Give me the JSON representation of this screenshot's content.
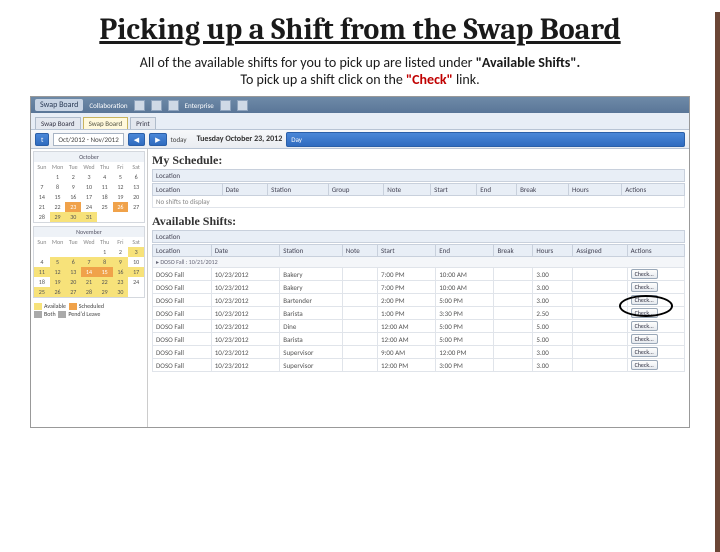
{
  "title": "Picking up a Shift from the Swap Board",
  "body_line1_a": "All of the available shifts for you to pick up are listed under ",
  "body_line1_b": "\"Available Shifts\".",
  "body_line2_a": "To pick up a shift click on the ",
  "body_line2_b": "\"Check\"",
  "body_line2_c": " link.",
  "app": {
    "top_tab": "Swap Board",
    "top_menu1": "Collaboration",
    "top_menu2": "Enterprise",
    "tabs": [
      "Swap Board",
      "Swap Board",
      "Print"
    ],
    "nav": {
      "btn": "t",
      "range": "Oct/2012 - Nov/2012",
      "today_sub": "today",
      "date": "Tuesday October 23, 2012",
      "day_btn": "Day"
    }
  },
  "cal": {
    "dow": [
      "Sun",
      "Mon",
      "Tue",
      "Wed",
      "Thu",
      "Fri",
      "Sat"
    ],
    "m1": {
      "name": "October",
      "rows": [
        [
          "",
          "1",
          "2",
          "3",
          "4",
          "5",
          "6"
        ],
        [
          "7",
          "8",
          "9",
          "10",
          "11",
          "12",
          "13"
        ],
        [
          "14",
          "15",
          "16",
          "17",
          "18",
          "19",
          "20"
        ],
        [
          "21",
          "22",
          "23",
          "24",
          "25",
          "26",
          "27"
        ],
        [
          "28",
          "29",
          "30",
          "31",
          "",
          "",
          ""
        ]
      ],
      "orange": [
        "23",
        "26"
      ],
      "yellow": [
        "29",
        "30",
        "31"
      ]
    },
    "m2": {
      "name": "November",
      "rows": [
        [
          "",
          "",
          "",
          "",
          "1",
          "2",
          "3"
        ],
        [
          "4",
          "5",
          "6",
          "7",
          "8",
          "9",
          "10"
        ],
        [
          "11",
          "12",
          "13",
          "14",
          "15",
          "16",
          "17"
        ],
        [
          "18",
          "19",
          "20",
          "21",
          "22",
          "23",
          "24"
        ],
        [
          "25",
          "26",
          "27",
          "28",
          "29",
          "30",
          ""
        ]
      ],
      "orange": [
        "14",
        "15"
      ],
      "yellow": [
        "3",
        "5",
        "6",
        "7",
        "8",
        "9",
        "11",
        "12",
        "13",
        "16",
        "17",
        "19",
        "20",
        "21",
        "22",
        "23",
        "25",
        "26",
        "27",
        "28",
        "29",
        "30"
      ]
    },
    "legend": {
      "a": "Available",
      "s": "Scheduled",
      "b": "Both",
      "p": "Pend'd Leave"
    }
  },
  "sched": {
    "title": "My Schedule:",
    "sub": "Location",
    "cols": [
      "Location",
      "Date",
      "Station",
      "Group",
      "Note",
      "Start",
      "End",
      "Break",
      "Hours",
      "Actions"
    ],
    "empty": "No shifts to display"
  },
  "avail": {
    "title": "Available Shifts:",
    "sub": "Location",
    "cols": [
      "Location",
      "Date",
      "Station",
      "Note",
      "Start",
      "End",
      "Break",
      "Hours",
      "Assigned",
      "Actions"
    ],
    "group": "DOSO Fall : 10/21/2012",
    "rows": [
      {
        "loc": "DOSO Fall",
        "date": "10/23/2012",
        "station": "Bakery",
        "note": "",
        "start": "7:00 PM",
        "end": "10:00 AM",
        "break": "",
        "hours": "3.00",
        "assigned": "",
        "action": "Check..."
      },
      {
        "loc": "DOSO Fall",
        "date": "10/23/2012",
        "station": "Bakery",
        "note": "",
        "start": "7:00 PM",
        "end": "10:00 AM",
        "break": "",
        "hours": "3.00",
        "assigned": "",
        "action": "Check..."
      },
      {
        "loc": "DOSO Fall",
        "date": "10/23/2012",
        "station": "Bartender",
        "note": "",
        "start": "2:00 PM",
        "end": "5:00 PM",
        "break": "",
        "hours": "3.00",
        "assigned": "",
        "action": "Check..."
      },
      {
        "loc": "DOSO Fall",
        "date": "10/23/2012",
        "station": "Barista",
        "note": "",
        "start": "1:00 PM",
        "end": "3:30 PM",
        "break": "",
        "hours": "2.50",
        "assigned": "",
        "action": "Check..."
      },
      {
        "loc": "DOSO Fall",
        "date": "10/23/2012",
        "station": "Dine",
        "note": "",
        "start": "12:00 AM",
        "end": "5:00 PM",
        "break": "",
        "hours": "5.00",
        "assigned": "",
        "action": "Check..."
      },
      {
        "loc": "DOSO Fall",
        "date": "10/23/2012",
        "station": "Barista",
        "note": "",
        "start": "12:00 AM",
        "end": "5:00 PM",
        "break": "",
        "hours": "5.00",
        "assigned": "",
        "action": "Check..."
      },
      {
        "loc": "DOSO Fall",
        "date": "10/23/2012",
        "station": "Supervisor",
        "note": "",
        "start": "9:00 AM",
        "end": "12:00 PM",
        "break": "",
        "hours": "3.00",
        "assigned": "",
        "action": "Check..."
      },
      {
        "loc": "DOSO Fall",
        "date": "10/23/2012",
        "station": "Supervisor",
        "note": "",
        "start": "12:00 PM",
        "end": "3:00 PM",
        "break": "",
        "hours": "3.00",
        "assigned": "",
        "action": "Check..."
      }
    ]
  }
}
